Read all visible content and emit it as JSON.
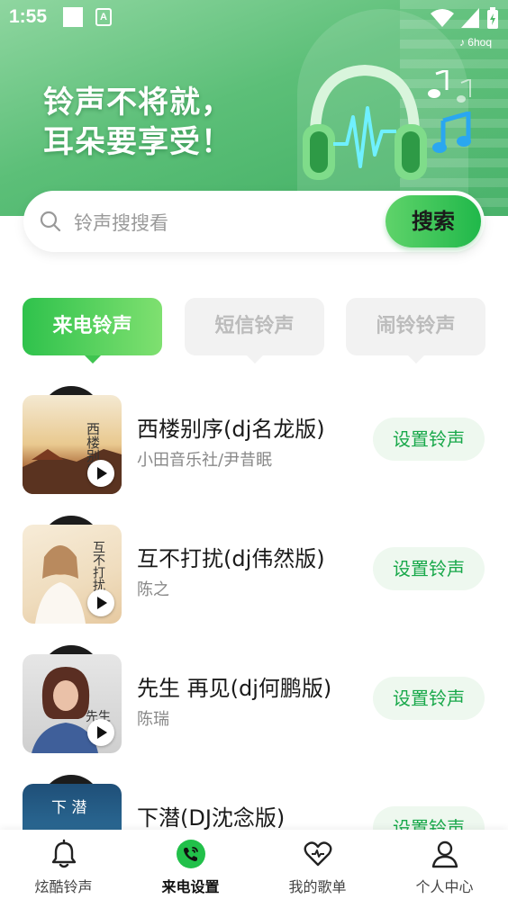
{
  "status_bar": {
    "time": "1:55",
    "a_icon": "A"
  },
  "hero": {
    "title_line1": "铃声不将就，",
    "title_line2": "耳朵要享受！",
    "tag": "6hoq"
  },
  "search": {
    "placeholder": "铃声搜搜看",
    "button": "搜索"
  },
  "tabs": [
    {
      "label": "来电铃声",
      "active": true
    },
    {
      "label": "短信铃声",
      "active": false
    },
    {
      "label": "闹铃铃声",
      "active": false
    }
  ],
  "songs": [
    {
      "title": "西楼别序(dj名龙版)",
      "artist": "小田音乐社/尹昔眠",
      "action": "设置铃声"
    },
    {
      "title": "互不打扰(dj伟然版)",
      "artist": "陈之",
      "action": "设置铃声"
    },
    {
      "title": "先生 再见(dj何鹏版)",
      "artist": "陈瑞",
      "action": "设置铃声"
    },
    {
      "title": "下潜(DJ沈念版)",
      "artist": "",
      "action": "设置铃声"
    }
  ],
  "covers": [
    {
      "text": "西楼别序"
    },
    {
      "text": "互不打扰"
    },
    {
      "text": "先生"
    },
    {
      "text": "下 潜"
    }
  ],
  "bottom_nav": [
    {
      "label": "炫酷铃声",
      "icon": "bell-icon"
    },
    {
      "label": "来电设置",
      "icon": "phone-call-icon",
      "active": true
    },
    {
      "label": "我的歌单",
      "icon": "heart-icon"
    },
    {
      "label": "个人中心",
      "icon": "user-icon"
    }
  ],
  "colors": {
    "accent": "#20b84a",
    "button_bg": "#eef8ef",
    "button_text": "#18a84a"
  }
}
